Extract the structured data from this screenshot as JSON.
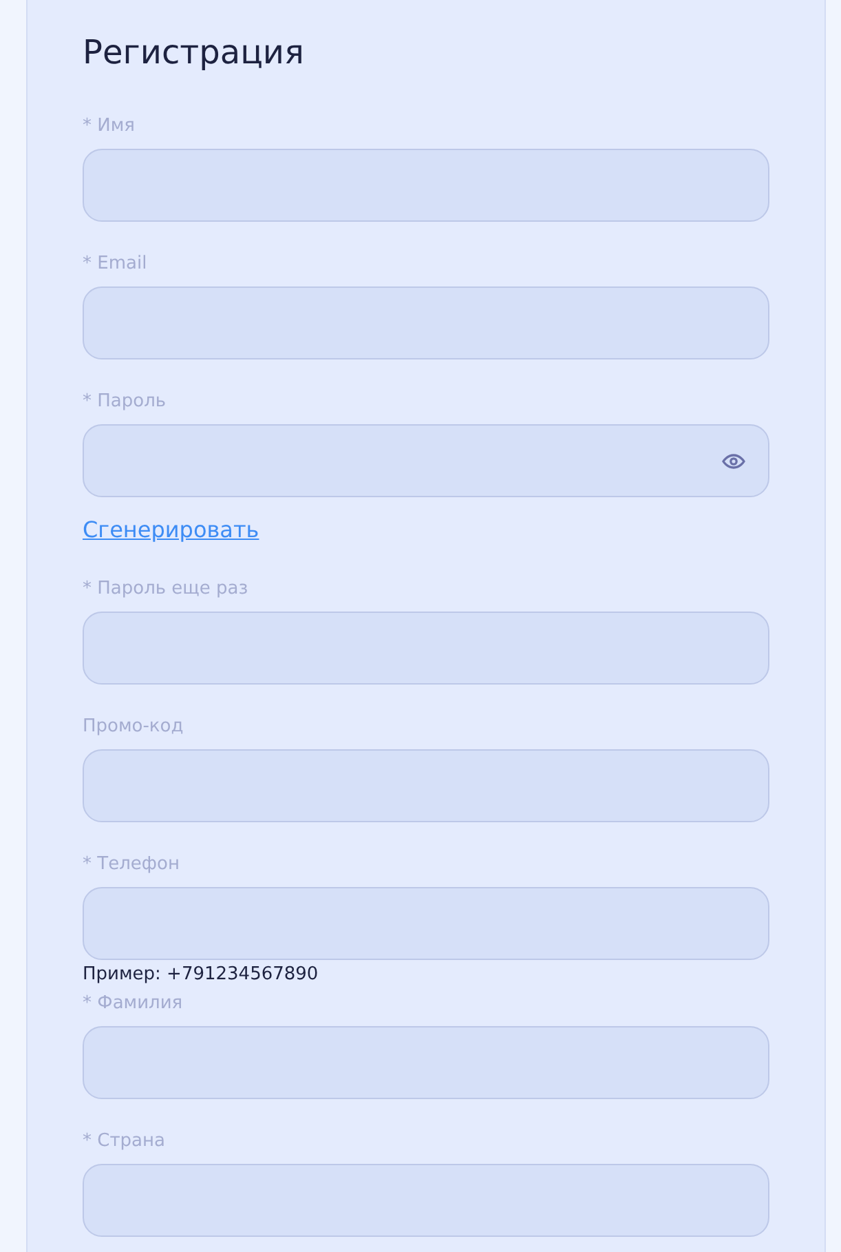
{
  "form": {
    "title": "Регистрация",
    "fields": [
      {
        "kind": "text",
        "label": "* Имя"
      },
      {
        "kind": "text",
        "label": "* Email"
      },
      {
        "kind": "password",
        "label": "* Пароль",
        "link": "Сгенерировать"
      },
      {
        "kind": "password_repeat",
        "label": "* Пароль еще раз"
      },
      {
        "kind": "text",
        "label": "Промо-код"
      },
      {
        "kind": "text",
        "label": "* Телефон",
        "hint": "Пример: +791234567890"
      },
      {
        "kind": "text",
        "label": "* Фамилия"
      },
      {
        "kind": "text",
        "label": "* Страна"
      }
    ]
  }
}
